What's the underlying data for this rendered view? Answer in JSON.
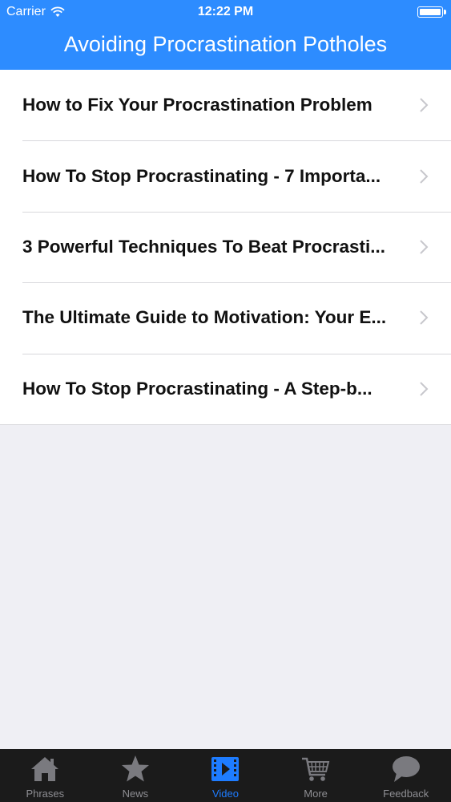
{
  "status_bar": {
    "carrier": "Carrier",
    "time": "12:22 PM"
  },
  "nav": {
    "title": "Avoiding Procrastination Potholes"
  },
  "list": {
    "items": [
      {
        "label": "How to Fix Your Procrastination Problem"
      },
      {
        "label": "How To Stop Procrastinating - 7 Importa..."
      },
      {
        "label": "3 Powerful Techniques To Beat Procrasti..."
      },
      {
        "label": "The Ultimate Guide to Motivation: Your E..."
      },
      {
        "label": "How To Stop Procrastinating - A Step-b..."
      }
    ]
  },
  "tab_bar": {
    "active": "Video",
    "tabs": [
      {
        "label": "Phrases",
        "icon": "home-icon"
      },
      {
        "label": "News",
        "icon": "star-icon"
      },
      {
        "label": "Video",
        "icon": "film-icon"
      },
      {
        "label": "More",
        "icon": "cart-icon"
      },
      {
        "label": "Feedback",
        "icon": "speech-bubble-icon"
      }
    ]
  },
  "colors": {
    "accent": "#2d8cff",
    "tab_active": "#1e7cff",
    "tab_inactive": "#8e8e93",
    "tab_bar_bg": "#1b1b1b",
    "background": "#efeff4"
  }
}
